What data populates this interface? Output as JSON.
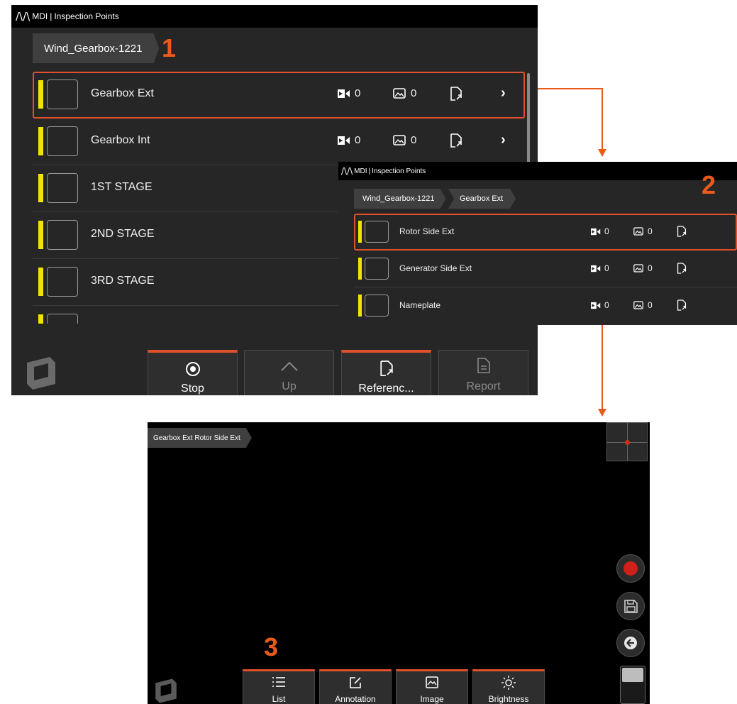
{
  "screen1": {
    "title": {
      "brand": "MDI",
      "sep": "|",
      "text": "Inspection Points"
    },
    "breadcrumb": "Wind_Gearbox-1221",
    "rows": [
      {
        "label": "Gearbox Ext",
        "video": "0",
        "image": "0"
      },
      {
        "label": "Gearbox Int",
        "video": "0",
        "image": "0"
      },
      {
        "label": "1ST STAGE"
      },
      {
        "label": "2ND STAGE"
      },
      {
        "label": "3RD STAGE"
      }
    ],
    "softkeys": [
      "Stop",
      "Up",
      "Referenc...",
      "Report"
    ]
  },
  "screen2": {
    "title": {
      "brand": "MDI",
      "sep": "|",
      "text": "Inspection Points"
    },
    "breadcrumbs": [
      "Wind_Gearbox-1221",
      "Gearbox Ext"
    ],
    "rows": [
      {
        "label": "Rotor Side Ext",
        "video": "0",
        "image": "0"
      },
      {
        "label": "Generator Side Ext",
        "video": "0",
        "image": "0"
      },
      {
        "label": "Nameplate",
        "video": "0",
        "image": "0"
      }
    ]
  },
  "screen3": {
    "breadcrumb": "Gearbox Ext Rotor Side Ext",
    "softkeys": [
      "List",
      "Annotation",
      "Image",
      "Brightness"
    ]
  },
  "callouts": [
    "1",
    "2",
    "3"
  ],
  "colors": {
    "accent": "#e0502a",
    "callout": "#ea5a1c",
    "marker": "#f2e400",
    "record": "#d0201a"
  }
}
